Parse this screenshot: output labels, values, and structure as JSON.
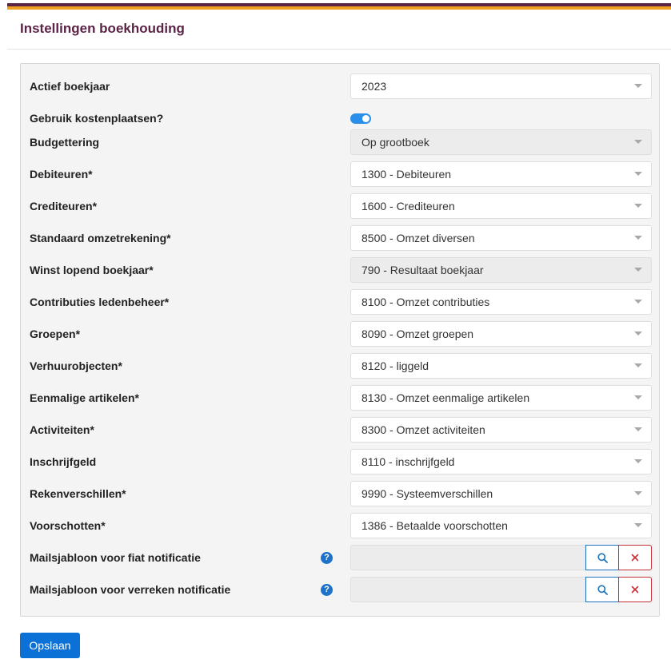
{
  "header": {
    "title": "Instellingen boekhouding"
  },
  "colors": {
    "brand": "#5b2346",
    "accent": "#f0a020",
    "primary": "#0c71d6",
    "danger": "#c6303a"
  },
  "fields": [
    {
      "label": "Actief boekjaar",
      "type": "select",
      "value": "2023",
      "disabled": false
    },
    {
      "label": "Gebruik kostenplaatsen?",
      "type": "toggle",
      "checked": true
    },
    {
      "label": "Budgettering",
      "type": "select",
      "value": "Op grootboek",
      "disabled": true
    },
    {
      "label": "Debiteuren*",
      "type": "select",
      "value": "1300 - Debiteuren",
      "disabled": false
    },
    {
      "label": "Crediteuren*",
      "type": "select",
      "value": "1600 - Crediteuren",
      "disabled": false
    },
    {
      "label": "Standaard omzetrekening*",
      "type": "select",
      "value": "8500 - Omzet diversen",
      "disabled": false
    },
    {
      "label": "Winst lopend boekjaar*",
      "type": "select",
      "value": "790 - Resultaat boekjaar",
      "disabled": true
    },
    {
      "label": "Contributies ledenbeheer*",
      "type": "select",
      "value": "8100 - Omzet contributies",
      "disabled": false
    },
    {
      "label": "Groepen*",
      "type": "select",
      "value": "8090 - Omzet groepen",
      "disabled": false
    },
    {
      "label": "Verhuurobjecten*",
      "type": "select",
      "value": "8120 - liggeld",
      "disabled": false
    },
    {
      "label": "Eenmalige artikelen*",
      "type": "select",
      "value": "8130 - Omzet eenmalige artikelen",
      "disabled": false
    },
    {
      "label": "Activiteiten*",
      "type": "select",
      "value": "8300 - Omzet activiteiten",
      "disabled": false
    },
    {
      "label": "Inschrijfgeld",
      "type": "select",
      "value": "8110 - inschrijfgeld",
      "disabled": false
    },
    {
      "label": "Rekenverschillen*",
      "type": "select",
      "value": "9990 - Systeemverschillen",
      "disabled": false
    },
    {
      "label": "Voorschotten*",
      "type": "select",
      "value": "1386 - Betaalde voorschotten",
      "disabled": false
    },
    {
      "label": "Mailsjabloon voor fiat notificatie",
      "type": "lookup",
      "value": "",
      "help": "?"
    },
    {
      "label": "Mailsjabloon voor verreken notificatie",
      "type": "lookup",
      "value": "",
      "help": "?"
    }
  ],
  "icons": {
    "search": "search-icon",
    "clear": "close-icon",
    "help": "help-icon",
    "caret": "chevron-down-icon"
  },
  "actions": {
    "save_label": "Opslaan"
  }
}
